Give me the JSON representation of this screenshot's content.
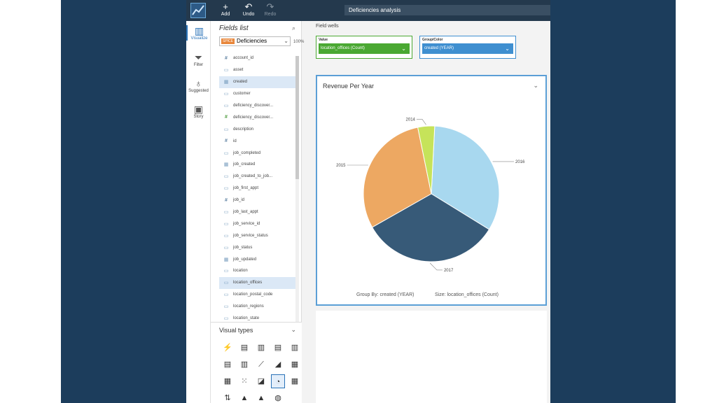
{
  "topbar": {
    "add_label": "Add",
    "undo_label": "Undo",
    "redo_label": "Redo",
    "analysis_name": "Deficiencies analysis"
  },
  "rail": {
    "items": [
      {
        "label": "Visualize",
        "icon": "bar-chart-icon"
      },
      {
        "label": "Filter",
        "icon": "funnel-icon"
      },
      {
        "label": "Suggested",
        "icon": "lightbulb-icon"
      },
      {
        "label": "Story",
        "icon": "play-icon"
      }
    ]
  },
  "fields_panel": {
    "title": "Fields list",
    "dataset_badge": "SPICE",
    "dataset_name": "Deficiencies",
    "percent": "100%",
    "fields": [
      {
        "name": "account_id",
        "type": "measure"
      },
      {
        "name": "asset",
        "type": "dimension"
      },
      {
        "name": "created",
        "type": "date",
        "selected": true
      },
      {
        "name": "customer",
        "type": "dimension"
      },
      {
        "name": "deficiency_discover...",
        "type": "dimension"
      },
      {
        "name": "deficiency_discover...",
        "type": "measure-green"
      },
      {
        "name": "description",
        "type": "dimension"
      },
      {
        "name": "id",
        "type": "measure"
      },
      {
        "name": "job_completed",
        "type": "dimension"
      },
      {
        "name": "job_created",
        "type": "date"
      },
      {
        "name": "job_created_to_job...",
        "type": "dimension"
      },
      {
        "name": "job_first_appt",
        "type": "dimension"
      },
      {
        "name": "job_id",
        "type": "measure"
      },
      {
        "name": "job_last_appt",
        "type": "dimension"
      },
      {
        "name": "job_service_id",
        "type": "dimension"
      },
      {
        "name": "job_service_status",
        "type": "dimension"
      },
      {
        "name": "job_status",
        "type": "dimension"
      },
      {
        "name": "job_updated",
        "type": "date"
      },
      {
        "name": "location",
        "type": "dimension"
      },
      {
        "name": "location_offices",
        "type": "dimension",
        "selected": true
      },
      {
        "name": "location_postal_code",
        "type": "dimension"
      },
      {
        "name": "location_regions",
        "type": "dimension"
      },
      {
        "name": "location_state",
        "type": "dimension"
      }
    ]
  },
  "visual_types": {
    "title": "Visual types",
    "items": [
      "⚡",
      "▤",
      "▥",
      "▤",
      "▥",
      "▤",
      "▥",
      "⟋",
      "◢",
      "▦",
      "▦",
      "⁙",
      "◪",
      "◔",
      "▦",
      "⇅",
      "▲",
      "▲",
      "◍"
    ],
    "selected_index": 13
  },
  "field_wells": {
    "label": "Field wells",
    "value": {
      "title": "Value",
      "field": "location_offices (Count)",
      "color": "#4aa832"
    },
    "group": {
      "title": "Group/Color",
      "field": "created (YEAR)",
      "color": "#3f8fd0"
    }
  },
  "visual": {
    "title": "Revenue Per Year",
    "footer_group": "Group By: created (YEAR)",
    "footer_size": "Size: location_offices (Count)"
  },
  "chart_data": {
    "type": "pie",
    "title": "Revenue Per Year",
    "categories": [
      "2016",
      "2017",
      "2015",
      "2014"
    ],
    "values": [
      33,
      33,
      30,
      4
    ],
    "colors": [
      "#a8d8ef",
      "#375a78",
      "#eda862",
      "#c6e35a"
    ]
  }
}
